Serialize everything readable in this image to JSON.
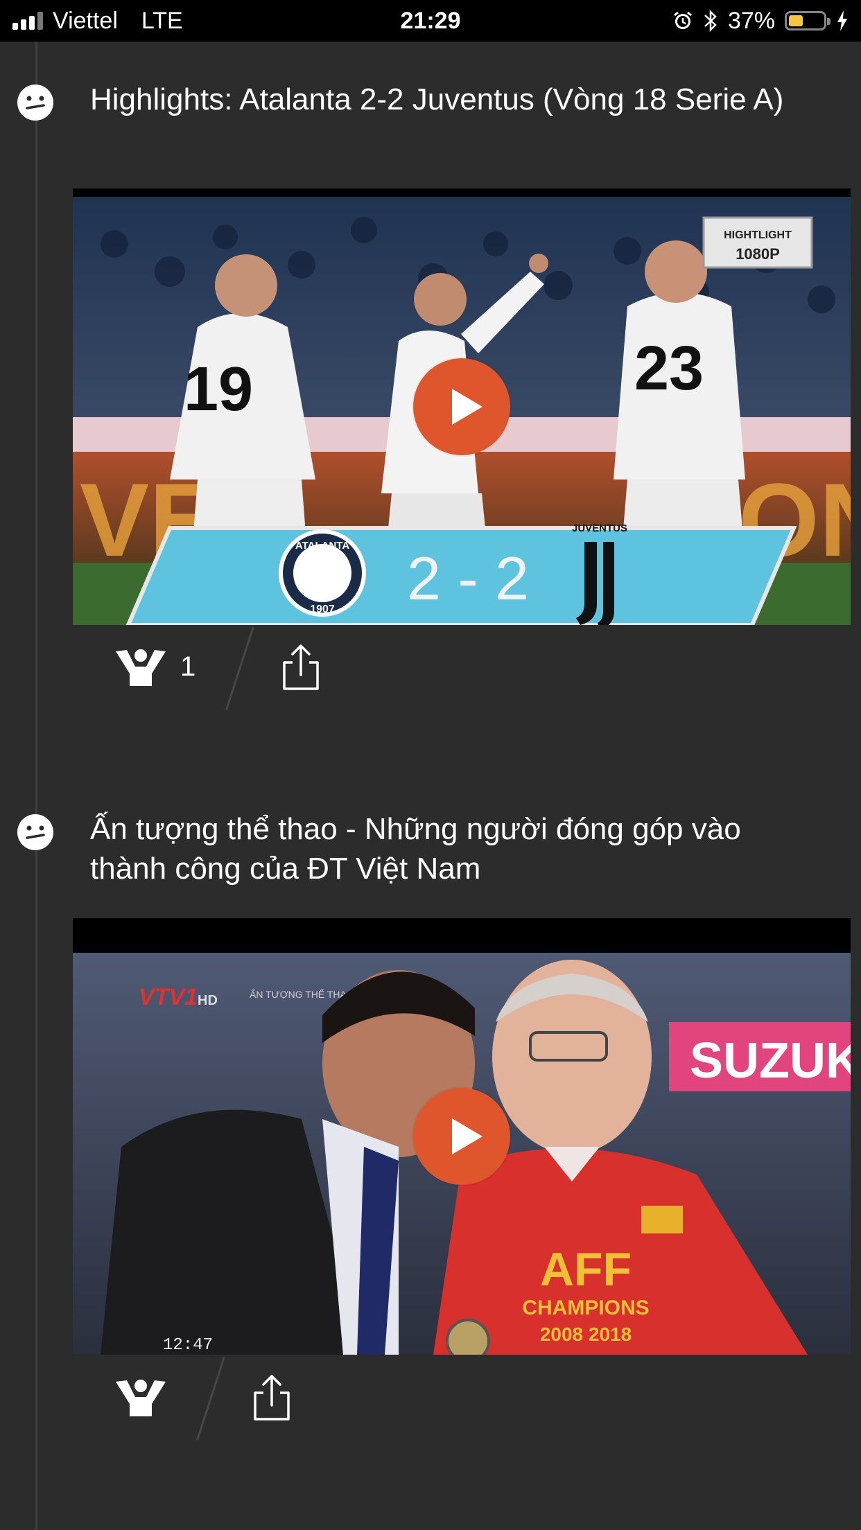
{
  "status_bar": {
    "carrier": "Viettel",
    "network": "LTE",
    "time": "21:29",
    "battery": "37%",
    "battery_level": 0.37,
    "icons": [
      "signal-icon",
      "alarm-icon",
      "bluetooth-icon",
      "battery-icon",
      "charging-icon"
    ]
  },
  "feed": [
    {
      "title": "Highlights: Atalanta 2-2 Juventus (Vòng 18 Serie A)",
      "icon": "face-icon",
      "thumbnail": {
        "badge_line1": "HIGHTLIGHT",
        "badge_line2": "1080P",
        "team_left": "ATALANTA",
        "team_left_year": "1907",
        "score": "2 - 2",
        "team_right": "JUVENTUS",
        "jersey_numbers": [
          "19",
          "23"
        ]
      },
      "likes": "1"
    },
    {
      "title": "Ấn tượng thể thao - Những người đóng góp vào thành công của ĐT Việt Nam",
      "icon": "face-icon",
      "thumbnail": {
        "channel_logo": "VTV1",
        "channel_suffix": "HD",
        "overlay_text": "ẤN TƯỢNG THỂ THAO 7 NGÀY",
        "shirt_text_1": "AFF",
        "shirt_text_2": "CHAMPIONS",
        "shirt_text_3": "2008   2018",
        "timestamp": "12:47",
        "banner_text": "SUZUKI"
      },
      "likes": ""
    }
  ],
  "colors": {
    "background": "#2c2c2c",
    "play_button": "#e0562c",
    "status_bar": "#000000"
  }
}
